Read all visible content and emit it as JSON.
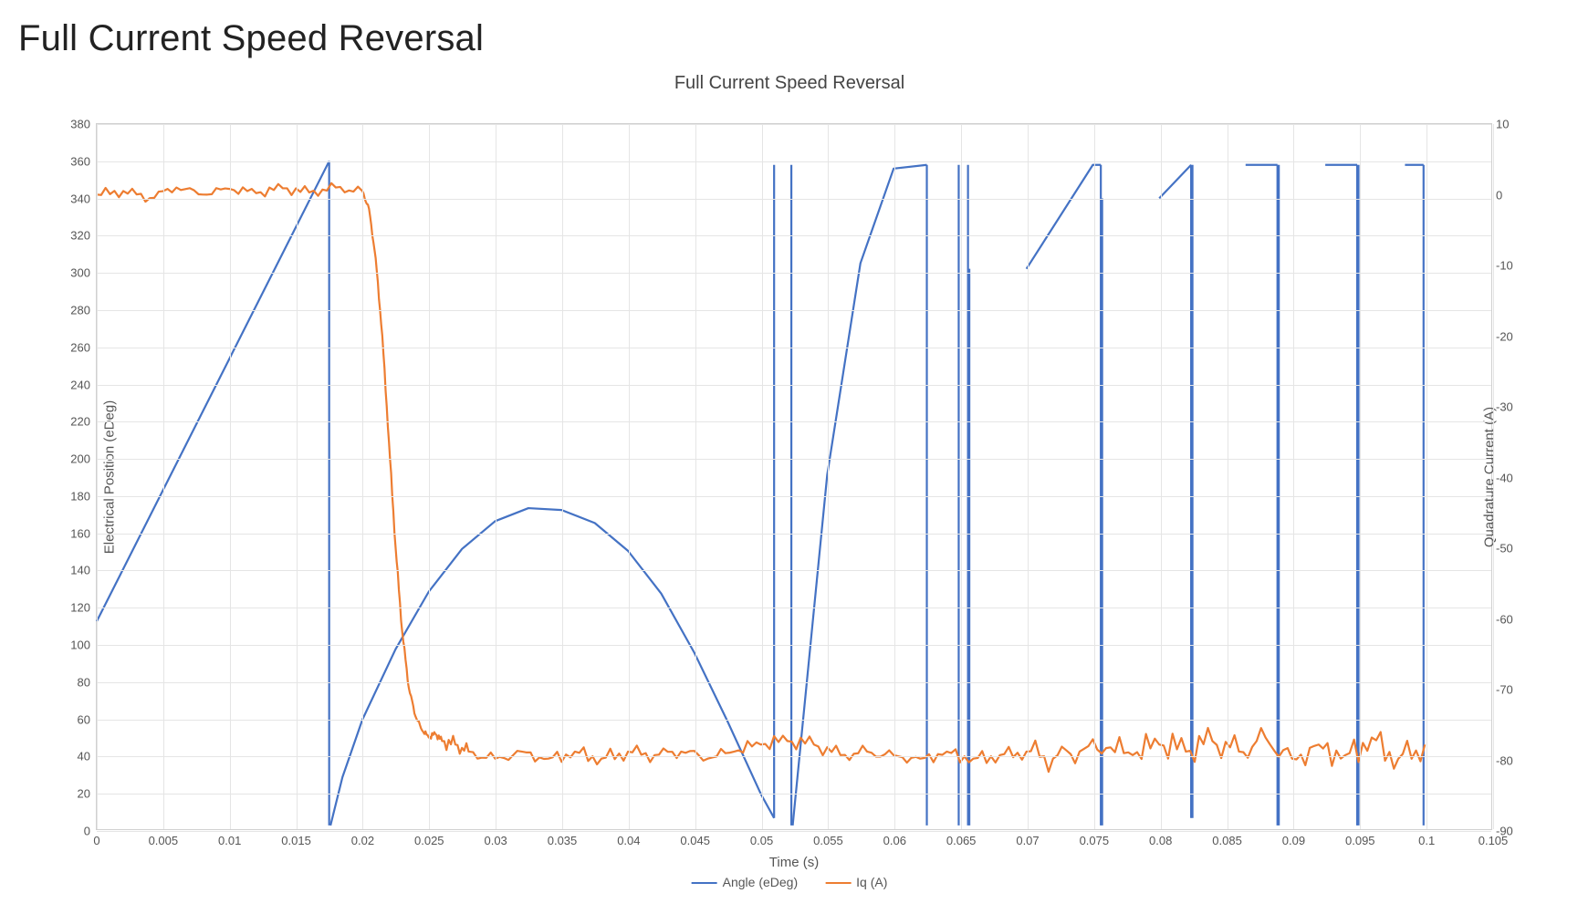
{
  "page_title": "Full Current Speed Reversal",
  "chart_data": {
    "type": "line",
    "title": "Full Current Speed Reversal",
    "xlabel": "Time (s)",
    "ylabel_left": "Electrical Position (eDeg)",
    "ylabel_right": "Quadrature Current (A)",
    "xlim": [
      0,
      0.105
    ],
    "ylim_left": [
      0,
      380
    ],
    "ylim_right": [
      -90,
      10
    ],
    "x_ticks": [
      0,
      0.005,
      0.01,
      0.015,
      0.02,
      0.025,
      0.03,
      0.035,
      0.04,
      0.045,
      0.05,
      0.055,
      0.06,
      0.065,
      0.07,
      0.075,
      0.08,
      0.085,
      0.09,
      0.095,
      0.1,
      0.105
    ],
    "y_ticks_left": [
      0,
      20,
      40,
      60,
      80,
      100,
      120,
      140,
      160,
      180,
      200,
      220,
      240,
      260,
      280,
      300,
      320,
      340,
      360,
      380
    ],
    "y_ticks_right": [
      -90,
      -80,
      -70,
      -60,
      -50,
      -40,
      -30,
      -20,
      -10,
      0,
      10
    ],
    "legend": [
      "Angle (eDeg)",
      "Iq (A)"
    ],
    "colors": {
      "angle": "#4472c4",
      "iq": "#ed7d31"
    },
    "series": [
      {
        "name": "Angle (eDeg)",
        "axis": "left",
        "color": "#4472c4",
        "x": [
          0,
          0.0175,
          0.0176,
          0.0185,
          0.02,
          0.0225,
          0.025,
          0.0275,
          0.03,
          0.0325,
          0.035,
          0.0375,
          0.04,
          0.0425,
          0.045,
          0.0475,
          0.05,
          0.051,
          0.0523,
          0.0524,
          0.055,
          0.0575,
          0.06,
          0.0625,
          0.0649,
          0.0656,
          0.0657,
          0.07,
          0.075,
          0.0756,
          0.0757,
          0.08,
          0.0824,
          0.0825,
          0.0865,
          0.0889,
          0.089,
          0.0925,
          0.0949,
          0.095,
          0.0985,
          0.0999,
          0.1
        ],
        "y": [
          112,
          360,
          2,
          28,
          59,
          97,
          128,
          151,
          166,
          173,
          172,
          165,
          150,
          127,
          95,
          58,
          19,
          6,
          358,
          2,
          191,
          305,
          356,
          358,
          2,
          358,
          2,
          302,
          358,
          358,
          2,
          340,
          358,
          6,
          358,
          358,
          2,
          358,
          358,
          2,
          358,
          358,
          2
        ]
      },
      {
        "name": "Iq (A)",
        "axis": "right",
        "color": "#ed7d31",
        "x": [
          0,
          0.002,
          0.004,
          0.006,
          0.008,
          0.01,
          0.012,
          0.014,
          0.016,
          0.018,
          0.02,
          0.0205,
          0.021,
          0.0215,
          0.022,
          0.0225,
          0.023,
          0.0235,
          0.024,
          0.0245,
          0.025,
          0.0255,
          0.026,
          0.027,
          0.028,
          0.03,
          0.032,
          0.034,
          0.036,
          0.038,
          0.04,
          0.042,
          0.044,
          0.046,
          0.048,
          0.05,
          0.052,
          0.054,
          0.056,
          0.058,
          0.06,
          0.062,
          0.064,
          0.066,
          0.068,
          0.07,
          0.072,
          0.074,
          0.076,
          0.078,
          0.08,
          0.082,
          0.084,
          0.086,
          0.088,
          0.09,
          0.092,
          0.094,
          0.096,
          0.098,
          0.1
        ],
        "y": [
          0,
          0.5,
          -0.5,
          1,
          0,
          0.8,
          0.2,
          0.9,
          0.3,
          1,
          0.5,
          -2,
          -9,
          -20,
          -35,
          -50,
          -62,
          -70,
          -74,
          -76,
          -77,
          -76.5,
          -77.5,
          -78,
          -79,
          -80,
          -79,
          -80,
          -79,
          -80,
          -79,
          -79.5,
          -79,
          -80,
          -79,
          -78,
          -77.5,
          -78,
          -79.5,
          -79,
          -79.5,
          -80,
          -79,
          -80,
          -79.5,
          -79,
          -80,
          -79,
          -78.5,
          -79.5,
          -78,
          -79,
          -77.5,
          -79,
          -77,
          -80,
          -78,
          -79.5,
          -77,
          -80,
          -78
        ]
      }
    ]
  }
}
